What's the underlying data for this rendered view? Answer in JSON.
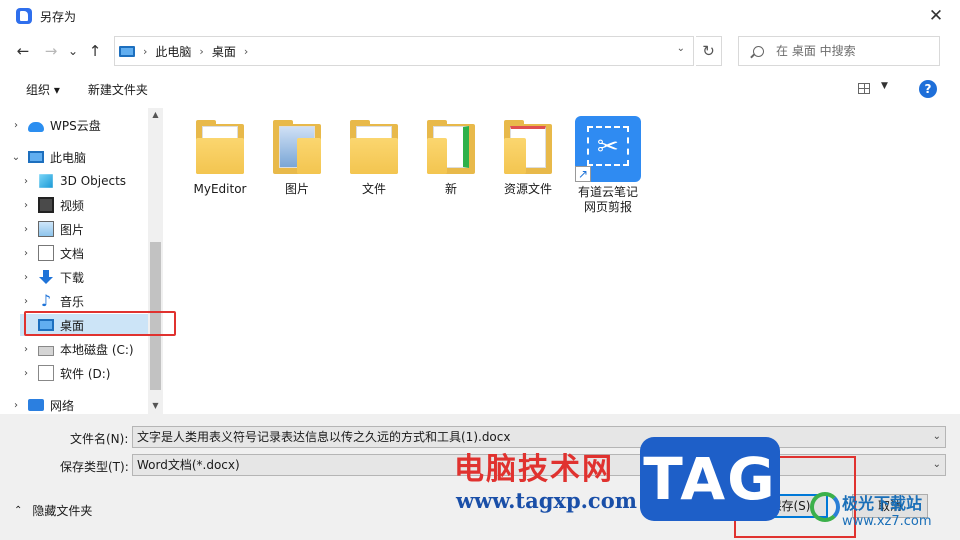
{
  "window": {
    "title": "另存为",
    "close_glyph": "✕"
  },
  "nav": {
    "back_glyph": "←",
    "forward_glyph": "→",
    "recent_glyph": "⌄",
    "up_glyph": "↑",
    "breadcrumb": [
      "此电脑",
      "桌面"
    ],
    "crumb_sep": "›",
    "dropdown_glyph": "⌄",
    "refresh_glyph": "↻",
    "search_placeholder": "在 桌面 中搜索"
  },
  "toolbar": {
    "organize": "组织 ▾",
    "new_folder": "新建文件夹",
    "view_dd": "▼",
    "help": "?"
  },
  "sidebar": {
    "items": [
      {
        "label": "WPS云盘",
        "icon": "cloud-icon",
        "arrow": "›"
      },
      {
        "label": "此电脑",
        "icon": "computer-icon",
        "arrow": "⌄"
      },
      {
        "label": "3D Objects",
        "icon": "cube-icon",
        "arrow": "›"
      },
      {
        "label": "视频",
        "icon": "video-icon",
        "arrow": "›"
      },
      {
        "label": "图片",
        "icon": "picture-icon",
        "arrow": "›"
      },
      {
        "label": "文档",
        "icon": "document-icon",
        "arrow": "›"
      },
      {
        "label": "下载",
        "icon": "download-icon",
        "arrow": "›"
      },
      {
        "label": "音乐",
        "icon": "music-icon",
        "arrow": "›"
      },
      {
        "label": "桌面",
        "icon": "desktop-icon",
        "arrow": ""
      },
      {
        "label": "本地磁盘 (C:)",
        "icon": "drive-icon",
        "arrow": "›"
      },
      {
        "label": "软件 (D:)",
        "icon": "blank-drive-icon",
        "arrow": "›"
      },
      {
        "label": "网络",
        "icon": "network-icon",
        "arrow": "›"
      }
    ],
    "music_glyph": "♪",
    "scroll_up": "▲",
    "scroll_down": "▼"
  },
  "files": [
    {
      "label": "MyEditor",
      "type": "folder"
    },
    {
      "label": "图片",
      "type": "folder"
    },
    {
      "label": "文件",
      "type": "folder"
    },
    {
      "label": "新",
      "type": "folder"
    },
    {
      "label": "资源文件",
      "type": "folder"
    },
    {
      "label": "有道云笔记\n网页剪报",
      "type": "shortcut"
    }
  ],
  "file_glyphs": {
    "scissor": "✂",
    "shortcut": "↗"
  },
  "bottom": {
    "filename_label": "文件名(N):",
    "filename_value": "文字是人类用表义符号记录表达信息以传之久远的方式和工具(1).docx",
    "filetype_label": "保存类型(T):",
    "filetype_value": "Word文档(*.docx)",
    "dd_glyph": "⌄",
    "hide_folders": "隐藏文件夹",
    "hide_glyph": "⌃",
    "save": "保存(S)",
    "cancel": "取消"
  },
  "watermark": {
    "line1": "电脑技术网",
    "line2": "www.tagxp.com",
    "tag": "TAG",
    "brand_cn": "极光下载站",
    "brand_url": "www.xz7.com"
  },
  "colors": {
    "accent": "#0078d7",
    "highlight": "#e0322f",
    "selected": "#cce4f7",
    "folder": "#f3c550"
  }
}
